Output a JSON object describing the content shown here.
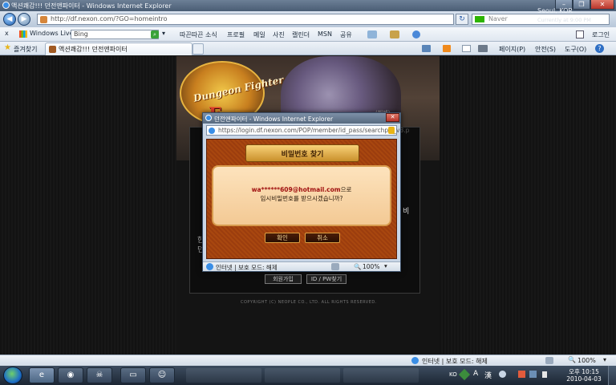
{
  "browser": {
    "title": "액션쾌감!!! 던전앤파이터 - Windows Internet Explorer",
    "url": "http://df.nexon.com/?GO=homeintro",
    "search_placeholder": "Naver",
    "weather": "Seoul, KOR",
    "weather_sub": "Currently at 9:00 PM"
  },
  "toolbar": {
    "close": "x",
    "live": "Windows Live",
    "bing_value": "Bing",
    "links": [
      "따끈따끈 소식",
      "프로필",
      "메일",
      "사진",
      "캘린더",
      "MSN",
      "공유"
    ],
    "login": "로그인"
  },
  "favorites": {
    "label": "즐겨찾기",
    "tab_title": "액션쾌감!!! 던전앤파이터",
    "page_menu": "페이지(P)",
    "safety_menu": "안전(S)",
    "tools_menu": "도구(O)"
  },
  "page": {
    "logo_text": "Dungeon Fighter",
    "logo_letter": "F",
    "copyright": "COPYRIGHT (C) NEOPLE CO., LTD. ALL RIGHTS RESERVED.",
    "join_button": "회원가입",
    "find_button": "ID / PW찾기",
    "fragment_left": "한",
    "fragment_left2": "던",
    "fragment_right": "비",
    "fragment_top": "(해제)"
  },
  "popup": {
    "title": "던전앤파이터 - Windows Internet Explorer",
    "url": "https://login.df.nexon.com/POP/member/id_pass/searchpw_v3.p",
    "heading": "비밀번호 찾기",
    "email": "wa******609@hotmail.com",
    "email_suffix": "으로",
    "message": "임시비밀번호를 받으시겠습니까?",
    "confirm": "확인",
    "cancel": "취소",
    "status_zone": "인터넷 | 보호 모드: 해제",
    "zoom": "100%"
  },
  "statusbar": {
    "zone": "인터넷 | 보호 모드: 해제",
    "zoom": "100%"
  },
  "taskbar": {
    "lang": "KO",
    "time": "오후 10:15",
    "date": "2010-04-03"
  }
}
